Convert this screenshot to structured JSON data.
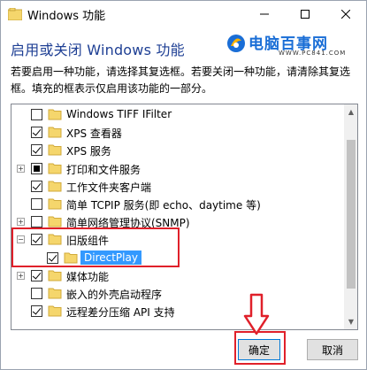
{
  "window": {
    "title": "Windows 功能",
    "controls": {
      "minimize": "—",
      "maximize": "□",
      "close": "✕"
    }
  },
  "header": {
    "heading": "启用或关闭 Windows 功能",
    "description": "若要启用一种功能，请选择其复选框。若要关闭一种功能，请清除其复选框。填充的框表示仅启用该功能的一部分。"
  },
  "watermark": {
    "title": "电脑百事网",
    "url": "WWW.PC841.COM"
  },
  "features": [
    {
      "label": "Windows TIFF IFilter",
      "state": "unchecked",
      "expander": ""
    },
    {
      "label": "XPS 查看器",
      "state": "checked",
      "expander": ""
    },
    {
      "label": "XPS 服务",
      "state": "checked",
      "expander": ""
    },
    {
      "label": "打印和文件服务",
      "state": "partial",
      "expander": "+"
    },
    {
      "label": "工作文件夹客户端",
      "state": "checked",
      "expander": ""
    },
    {
      "label": "简单 TCPIP 服务(即 echo、daytime 等)",
      "state": "unchecked",
      "expander": ""
    },
    {
      "label": "简单网络管理协议(SNMP)",
      "state": "unchecked",
      "expander": "+"
    },
    {
      "label": "旧版组件",
      "state": "checked",
      "expander": "−"
    },
    {
      "label": "DirectPlay",
      "state": "checked",
      "expander": "",
      "child": true,
      "selected": true
    },
    {
      "label": "媒体功能",
      "state": "checked",
      "expander": "+"
    },
    {
      "label": "嵌入的外壳启动程序",
      "state": "unchecked",
      "expander": ""
    },
    {
      "label": "远程差分压缩 API 支持",
      "state": "checked",
      "expander": ""
    }
  ],
  "buttons": {
    "ok": "确定",
    "cancel": "取消"
  },
  "colors": {
    "heading": "#1e3f94",
    "selection": "#3399ff",
    "highlight": "#e0202a",
    "folder": "#f5d66c"
  }
}
